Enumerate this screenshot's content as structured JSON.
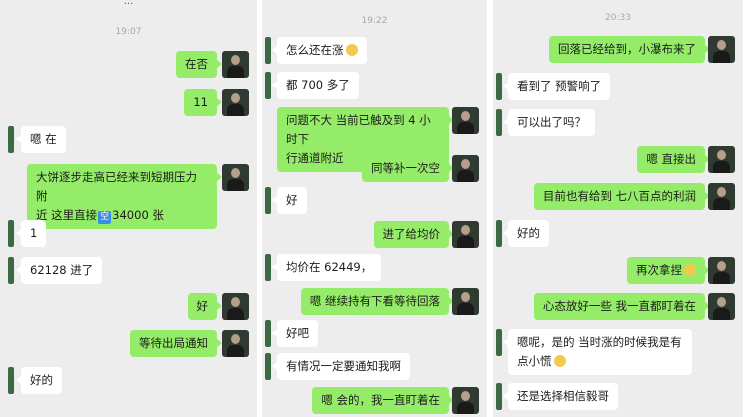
{
  "panel1": {
    "top_cut": "...",
    "timestamp": "19:07",
    "messages": [
      {
        "text": "在否"
      },
      {
        "text": "11"
      },
      {
        "text": "嗯 在"
      },
      {
        "line1": "大饼逐步走高已经来到短期压力附",
        "line2a": "近 这里直接",
        "tag": "空",
        "line2b": "34000 张"
      },
      {
        "text": "1"
      },
      {
        "text": "62128 进了"
      },
      {
        "text": "好"
      },
      {
        "text": "等待出局通知"
      },
      {
        "text": "好的"
      }
    ]
  },
  "panel2": {
    "timestamp": "19:22",
    "messages": [
      {
        "text": "怎么还在涨",
        "emoji": "sweat-smile-emoji"
      },
      {
        "text": "都 700 多了"
      },
      {
        "line1": "问题不大 当前已触及到 4 小时下",
        "line2": "行通道附近"
      },
      {
        "text": "同等补一次空"
      },
      {
        "text": "好"
      },
      {
        "text": "进了给均价"
      },
      {
        "text": "均价在 62449，"
      },
      {
        "text": "嗯 继续持有下看等待回落"
      },
      {
        "text": "好吧"
      },
      {
        "text": "有情况一定要通知我啊"
      },
      {
        "text": "嗯 会的，我一直盯着在"
      }
    ]
  },
  "panel3": {
    "timestamp": "20:33",
    "messages": [
      {
        "text": "回落已经给到，小瀑布来了"
      },
      {
        "text": "看到了 预警响了"
      },
      {
        "text": "可以出了吗？"
      },
      {
        "text": "嗯 直接出"
      },
      {
        "text": "目前也有给到 七八百点的利润"
      },
      {
        "text": "好的"
      },
      {
        "text": "再次拿捏",
        "emoji": "grin-emoji"
      },
      {
        "text": "心态放好一些 我一直都盯着在"
      },
      {
        "line1": "嗯呢，是的 当时涨的时候我是有",
        "line2": "点小慌",
        "emoji": "sweat-smile-emoji"
      },
      {
        "text": "还是选择相信毅哥"
      }
    ]
  }
}
